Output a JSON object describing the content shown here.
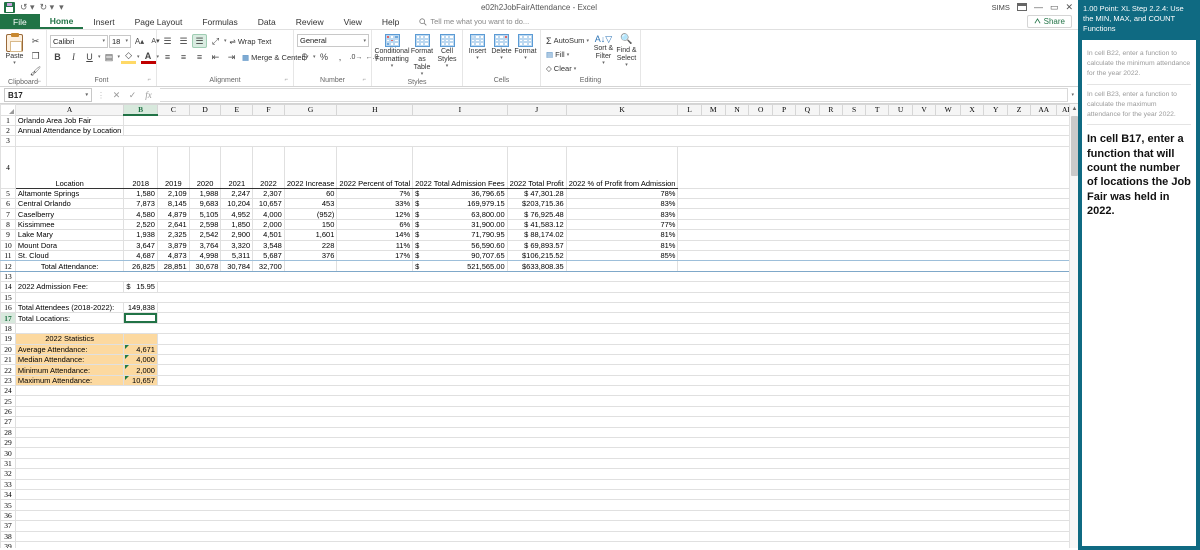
{
  "titlebar": {
    "document_title": "e02h2JobFairAttendance - Excel",
    "user": "SIMS",
    "quick_access": [
      "save-icon",
      "undo-icon",
      "redo-icon",
      "customize-icon"
    ],
    "window_controls": [
      "ribbon-display-icon",
      "minimize-icon",
      "restore-icon",
      "close-icon"
    ]
  },
  "tabs": {
    "file": "File",
    "items": [
      "Home",
      "Insert",
      "Page Layout",
      "Formulas",
      "Data",
      "Review",
      "View",
      "Help"
    ],
    "active": "Home",
    "tellme_placeholder": "Tell me what you want to do...",
    "share": "Share"
  },
  "ribbon": {
    "clipboard": {
      "label": "Clipboard",
      "paste": "Paste",
      "cut": "cut-icon",
      "copy": "copy-icon",
      "format_painter": "format-painter-icon"
    },
    "font": {
      "label": "Font",
      "font_name": "Calibri",
      "font_size": "18",
      "grow": "A",
      "shrink": "A",
      "bold": "B",
      "italic": "I",
      "underline": "U",
      "borders": "borders-icon",
      "fill_color": "fill-color-icon",
      "font_color": "font-color-icon"
    },
    "alignment": {
      "label": "Alignment",
      "wrap_text": "Wrap Text",
      "merge_center": "Merge & Center"
    },
    "number": {
      "label": "Number",
      "format": "General",
      "currency": "$",
      "percent": "%",
      "comma": ",",
      "increase_decimal": "increase-decimal-icon",
      "decrease_decimal": "decrease-decimal-icon"
    },
    "styles": {
      "label": "Styles",
      "conditional_formatting": "Conditional Formatting",
      "format_as_table": "Format as Table",
      "cell_styles": "Cell Styles"
    },
    "cells": {
      "label": "Cells",
      "insert": "Insert",
      "delete": "Delete",
      "format": "Format"
    },
    "editing": {
      "label": "Editing",
      "autosum": "AutoSum",
      "fill": "Fill",
      "clear": "Clear",
      "sort_filter": "Sort & Filter",
      "find_select": "Find & Select"
    }
  },
  "formula_bar": {
    "name_box": "B17",
    "formula": "",
    "cancel": "cancel-icon",
    "enter": "enter-icon",
    "insert_function": "insert-function-icon"
  },
  "grid": {
    "columns": [
      "A",
      "B",
      "C",
      "D",
      "E",
      "F",
      "G",
      "H",
      "I",
      "J",
      "K",
      "L",
      "M",
      "N",
      "O",
      "P",
      "Q",
      "R",
      "S",
      "T",
      "U",
      "V",
      "W",
      "X",
      "Y",
      "Z",
      "AA",
      "AB"
    ],
    "selected_column": "B",
    "selected_row": 17,
    "first_row": 1,
    "last_row": 39,
    "titles": {
      "line1": "Orlando Area Job Fair",
      "line2": "Annual Attendance by Location"
    },
    "headers": {
      "location": "Location",
      "y2018": "2018",
      "y2019": "2019",
      "y2020": "2020",
      "y2021": "2021",
      "y2022": "2022",
      "increase": "2022 Increase",
      "percent_total": "2022 Percent of Total",
      "admission_fees": "2022 Total Admission Fees",
      "total_profit": "2022 Total Profit",
      "pct_profit": "2022 % of Profit from Admission"
    },
    "rows": [
      {
        "location": "Altamonte Springs",
        "y2018": "1,580",
        "y2019": "2,109",
        "y2020": "1,988",
        "y2021": "2,247",
        "y2022": "2,307",
        "increase": "60",
        "percent_total": "7%",
        "fees_sym": "$",
        "fees": "36,796.65",
        "profit": "$  47,301.28",
        "pct_profit": "78%"
      },
      {
        "location": "Central Orlando",
        "y2018": "7,873",
        "y2019": "8,145",
        "y2020": "9,683",
        "y2021": "10,204",
        "y2022": "10,657",
        "increase": "453",
        "percent_total": "33%",
        "fees_sym": "$",
        "fees": "169,979.15",
        "profit": "$203,715.36",
        "pct_profit": "83%"
      },
      {
        "location": "Caselberry",
        "y2018": "4,580",
        "y2019": "4,879",
        "y2020": "5,105",
        "y2021": "4,952",
        "y2022": "4,000",
        "increase": "(952)",
        "percent_total": "12%",
        "fees_sym": "$",
        "fees": "63,800.00",
        "profit": "$  76,925.48",
        "pct_profit": "83%"
      },
      {
        "location": "Kissimmee",
        "y2018": "2,520",
        "y2019": "2,641",
        "y2020": "2,598",
        "y2021": "1,850",
        "y2022": "2,000",
        "increase": "150",
        "percent_total": "6%",
        "fees_sym": "$",
        "fees": "31,900.00",
        "profit": "$  41,583.12",
        "pct_profit": "77%"
      },
      {
        "location": "Lake Mary",
        "y2018": "1,938",
        "y2019": "2,325",
        "y2020": "2,542",
        "y2021": "2,900",
        "y2022": "4,501",
        "increase": "1,601",
        "percent_total": "14%",
        "fees_sym": "$",
        "fees": "71,790.95",
        "profit": "$  88,174.02",
        "pct_profit": "81%"
      },
      {
        "location": "Mount Dora",
        "y2018": "3,647",
        "y2019": "3,879",
        "y2020": "3,764",
        "y2021": "3,320",
        "y2022": "3,548",
        "increase": "228",
        "percent_total": "11%",
        "fees_sym": "$",
        "fees": "56,590.60",
        "profit": "$  69,893.57",
        "pct_profit": "81%"
      },
      {
        "location": "St. Cloud",
        "y2018": "4,687",
        "y2019": "4,873",
        "y2020": "4,998",
        "y2021": "5,311",
        "y2022": "5,687",
        "increase": "376",
        "percent_total": "17%",
        "fees_sym": "$",
        "fees": "90,707.65",
        "profit": "$106,215.52",
        "pct_profit": "85%"
      }
    ],
    "total_row": {
      "label": "Total Attendance:",
      "y2018": "26,825",
      "y2019": "28,851",
      "y2020": "30,678",
      "y2021": "30,784",
      "y2022": "32,700",
      "fees_sym": "$",
      "fees": "521,565.00",
      "profit": "$633,808.35"
    },
    "admission_fee": {
      "label": "2022 Admission Fee:",
      "symbol": "$",
      "value": "15.95"
    },
    "total_attendees": {
      "label": "Total Attendees (2018-2022):",
      "value": "149,838"
    },
    "total_locations": {
      "label": "Total Locations:",
      "value": ""
    },
    "statistics": {
      "header": "2022 Statistics",
      "items": [
        {
          "label": "Average Attendance:",
          "value": "4,671"
        },
        {
          "label": "Median Attendance:",
          "value": "4,000"
        },
        {
          "label": "Minimum Attendance:",
          "value": "2,000"
        },
        {
          "label": "Maximum Attendance:",
          "value": "10,657"
        }
      ]
    }
  },
  "panel": {
    "header": "1.00 Point: XL Step 2.2.4: Use the MIN, MAX, and COUNT Functions",
    "tasks": [
      {
        "text": "In cell B22, enter a function to calculate the minimum attendance for the year 2022.",
        "current": false
      },
      {
        "text": "In cell B23, enter a function to calculate the maximum attendance for the year 2022.",
        "current": false
      },
      {
        "text": "In cell B17, enter a function that will count the number of locations the Job Fair was held in 2022.",
        "current": true
      }
    ]
  },
  "colors": {
    "excel_green": "#217346",
    "panel_teal": "#0f6a82",
    "stat_fill": "#fcd9a0"
  }
}
